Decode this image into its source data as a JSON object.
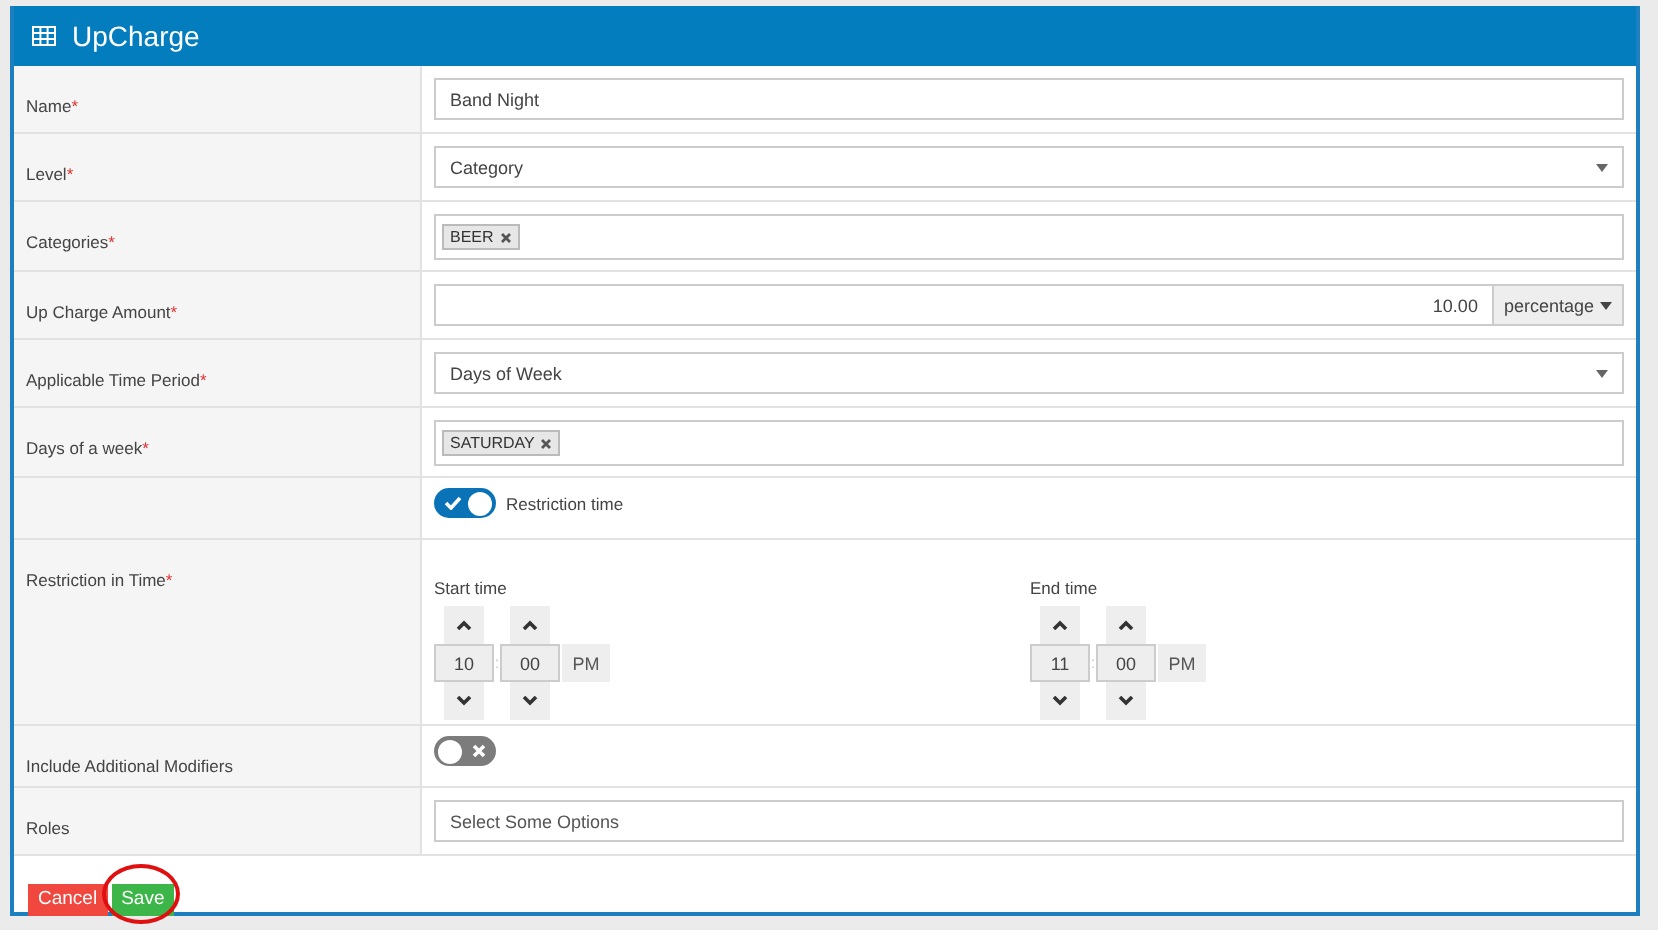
{
  "title": "UpCharge",
  "rows": [
    {
      "kind": "text",
      "label": "Name",
      "required": "*",
      "value": "Band Night"
    },
    {
      "kind": "select",
      "label": "Level",
      "required": "*",
      "value": "Category"
    },
    {
      "kind": "tags",
      "label": "Categories",
      "required": "*",
      "tags": [
        "BEER"
      ]
    },
    {
      "kind": "amount",
      "label": "Up Charge Amount",
      "required": "*",
      "value": "10.00",
      "unit": "percentage"
    },
    {
      "kind": "select",
      "label": "Applicable Time Period",
      "required": "*",
      "value": "Days of Week"
    },
    {
      "kind": "tags",
      "label": "Days of a week",
      "required": "*",
      "tags": [
        "SATURDAY"
      ]
    },
    {
      "kind": "toggle",
      "on": true,
      "text": "Restriction time"
    },
    {
      "kind": "time",
      "label": "Restriction in Time",
      "required": "*",
      "ranges": [
        {
          "caption": "Start time",
          "hour": "10",
          "separator": ":",
          "minute": "00",
          "period": "PM"
        },
        {
          "caption": "End time",
          "hour": "11",
          "separator": ":",
          "minute": "00",
          "period": "PM"
        }
      ]
    },
    {
      "kind": "toggle",
      "label": "Include Additional Modifiers",
      "on": false
    },
    {
      "kind": "multiselect",
      "label": "Roles",
      "placeholder": "Select Some Options"
    }
  ],
  "buttons": [
    {
      "label": "Cancel",
      "kind": "danger",
      "circled": false
    },
    {
      "label": "Save",
      "kind": "success",
      "circled": true
    }
  ]
}
